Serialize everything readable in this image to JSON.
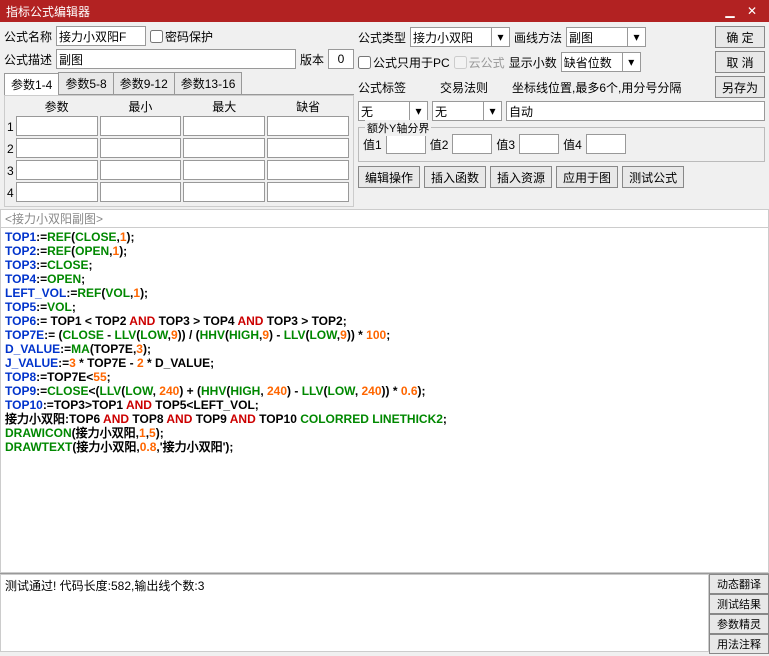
{
  "titlebar": {
    "title": "指标公式编辑器"
  },
  "labels": {
    "formulaName": "公式名称",
    "pwdProtect": "密码保护",
    "formulaDesc": "公式描述",
    "version": "版本",
    "formulaType": "公式类型",
    "drawMethod": "画线方法",
    "pcOnly": "公式只用于PC",
    "cloudFormula": "云公式",
    "showDecimal": "显示小数",
    "formulaTag": "公式标签",
    "tradeRule": "交易法则",
    "coordPos": "坐标线位置,最多6个,用分号分隔",
    "extraYAxis": "额外Y轴分界",
    "val1": "值1",
    "val2": "值2",
    "val3": "值3",
    "val4": "值4"
  },
  "values": {
    "formulaName": "接力小双阳F",
    "formulaDesc": "副图",
    "version": "0",
    "formulaType": "接力小双阳",
    "drawMethod": "副图",
    "showDecimal": "缺省位数",
    "formulaTag": "无",
    "tradeRule": "无",
    "coordPos": "自动",
    "v1": "",
    "v2": "",
    "v3": "",
    "v4": ""
  },
  "buttons": {
    "ok": "确 定",
    "cancel": "取 消",
    "saveAs": "另存为",
    "editOp": "编辑操作",
    "insertFunc": "插入函数",
    "insertRes": "插入资源",
    "applyChart": "应用于图",
    "testFormula": "测试公式",
    "dynTrans": "动态翻译",
    "testResult": "测试结果",
    "paramWiz": "参数精灵",
    "usageNote": "用法注释"
  },
  "paramTabs": [
    "参数1-4",
    "参数5-8",
    "参数9-12",
    "参数13-16"
  ],
  "paramCols": [
    "参数",
    "最小",
    "最大",
    "缺省"
  ],
  "paramRows": [
    "1",
    "2",
    "3",
    "4"
  ],
  "codeTitle": "<接力小双阳副图>",
  "code": {
    "lines": [
      [
        [
          "TOP1",
          0
        ],
        [
          ":=",
          1
        ],
        [
          "REF",
          2
        ],
        [
          "(",
          1
        ],
        [
          "CLOSE",
          2
        ],
        [
          ",",
          1
        ],
        [
          "1",
          3
        ],
        [
          ");",
          1
        ]
      ],
      [
        [
          "TOP2",
          0
        ],
        [
          ":=",
          1
        ],
        [
          "REF",
          2
        ],
        [
          "(",
          1
        ],
        [
          "OPEN",
          2
        ],
        [
          ",",
          1
        ],
        [
          "1",
          3
        ],
        [
          ");",
          1
        ]
      ],
      [
        [
          "TOP3",
          0
        ],
        [
          ":=",
          1
        ],
        [
          "CLOSE",
          2
        ],
        [
          ";",
          1
        ]
      ],
      [
        [
          "TOP4",
          0
        ],
        [
          ":=",
          1
        ],
        [
          "OPEN",
          2
        ],
        [
          ";",
          1
        ]
      ],
      [
        [
          "LEFT_VOL",
          0
        ],
        [
          ":=",
          1
        ],
        [
          "REF",
          2
        ],
        [
          "(",
          1
        ],
        [
          "VOL",
          2
        ],
        [
          ",",
          1
        ],
        [
          "1",
          3
        ],
        [
          ");",
          1
        ]
      ],
      [
        [
          "TOP5",
          0
        ],
        [
          ":=",
          1
        ],
        [
          "VOL",
          2
        ],
        [
          ";",
          1
        ]
      ],
      [
        [
          "TOP6",
          0
        ],
        [
          ":= TOP1 < TOP2 ",
          1
        ],
        [
          "AND",
          4
        ],
        [
          " TOP3 > TOP4 ",
          1
        ],
        [
          "AND",
          4
        ],
        [
          " TOP3 > TOP2;",
          1
        ]
      ],
      [
        [
          "TOP7E",
          0
        ],
        [
          ":= (",
          1
        ],
        [
          "CLOSE",
          2
        ],
        [
          " - ",
          1
        ],
        [
          "LLV",
          2
        ],
        [
          "(",
          1
        ],
        [
          "LOW",
          2
        ],
        [
          ",",
          1
        ],
        [
          "9",
          3
        ],
        [
          ")) / (",
          1
        ],
        [
          "HHV",
          2
        ],
        [
          "(",
          1
        ],
        [
          "HIGH",
          2
        ],
        [
          ",",
          1
        ],
        [
          "9",
          3
        ],
        [
          ") - ",
          1
        ],
        [
          "LLV",
          2
        ],
        [
          "(",
          1
        ],
        [
          "LOW",
          2
        ],
        [
          ",",
          1
        ],
        [
          "9",
          3
        ],
        [
          ")) * ",
          1
        ],
        [
          "100",
          3
        ],
        [
          ";",
          1
        ]
      ],
      [
        [
          "D_VALUE",
          0
        ],
        [
          ":=",
          1
        ],
        [
          "MA",
          2
        ],
        [
          "(TOP7E,",
          1
        ],
        [
          "3",
          3
        ],
        [
          ");",
          1
        ]
      ],
      [
        [
          "J_VALUE",
          0
        ],
        [
          ":=",
          1
        ],
        [
          "3",
          3
        ],
        [
          " * TOP7E - ",
          1
        ],
        [
          "2",
          3
        ],
        [
          " * D_VALUE;",
          1
        ]
      ],
      [
        [
          "TOP8",
          0
        ],
        [
          ":=TOP7E<",
          1
        ],
        [
          "55",
          3
        ],
        [
          ";",
          1
        ]
      ],
      [
        [
          "TOP9",
          0
        ],
        [
          ":=",
          1
        ],
        [
          "CLOSE",
          2
        ],
        [
          "<(",
          1
        ],
        [
          "LLV",
          2
        ],
        [
          "(",
          1
        ],
        [
          "LOW",
          2
        ],
        [
          ", ",
          1
        ],
        [
          "240",
          3
        ],
        [
          ") + (",
          1
        ],
        [
          "HHV",
          2
        ],
        [
          "(",
          1
        ],
        [
          "HIGH",
          2
        ],
        [
          ", ",
          1
        ],
        [
          "240",
          3
        ],
        [
          ") - ",
          1
        ],
        [
          "LLV",
          2
        ],
        [
          "(",
          1
        ],
        [
          "LOW",
          2
        ],
        [
          ", ",
          1
        ],
        [
          "240",
          3
        ],
        [
          ")) * ",
          1
        ],
        [
          "0.6",
          3
        ],
        [
          ");",
          1
        ]
      ],
      [
        [
          "TOP10",
          0
        ],
        [
          ":=TOP3>TOP1 ",
          1
        ],
        [
          "AND",
          4
        ],
        [
          " TOP5<LEFT_VOL;",
          1
        ]
      ],
      [
        [
          "接力小双阳",
          1
        ],
        [
          ":TOP6 ",
          1
        ],
        [
          "AND",
          4
        ],
        [
          " TOP8 ",
          1
        ],
        [
          "AND",
          4
        ],
        [
          " TOP9 ",
          1
        ],
        [
          "AND",
          4
        ],
        [
          " TOP10 ",
          1
        ],
        [
          "COLORRED",
          2
        ],
        [
          " ",
          1
        ],
        [
          "LINETHICK2",
          2
        ],
        [
          ";",
          1
        ]
      ],
      [
        [
          "DRAWICON",
          2
        ],
        [
          "(接力小双阳,",
          1
        ],
        [
          "1",
          3
        ],
        [
          ",",
          1
        ],
        [
          "5",
          3
        ],
        [
          ");",
          1
        ]
      ],
      [
        [
          "DRAWTEXT",
          2
        ],
        [
          "(接力小双阳,",
          1
        ],
        [
          "0.8",
          3
        ],
        [
          ",'接力小双阳');",
          1
        ]
      ]
    ],
    "cls": [
      "kw-blue",
      "kw-black",
      "kw-green",
      "kw-orange",
      "kw-red"
    ]
  },
  "status": "测试通过! 代码长度:582,输出线个数:3"
}
